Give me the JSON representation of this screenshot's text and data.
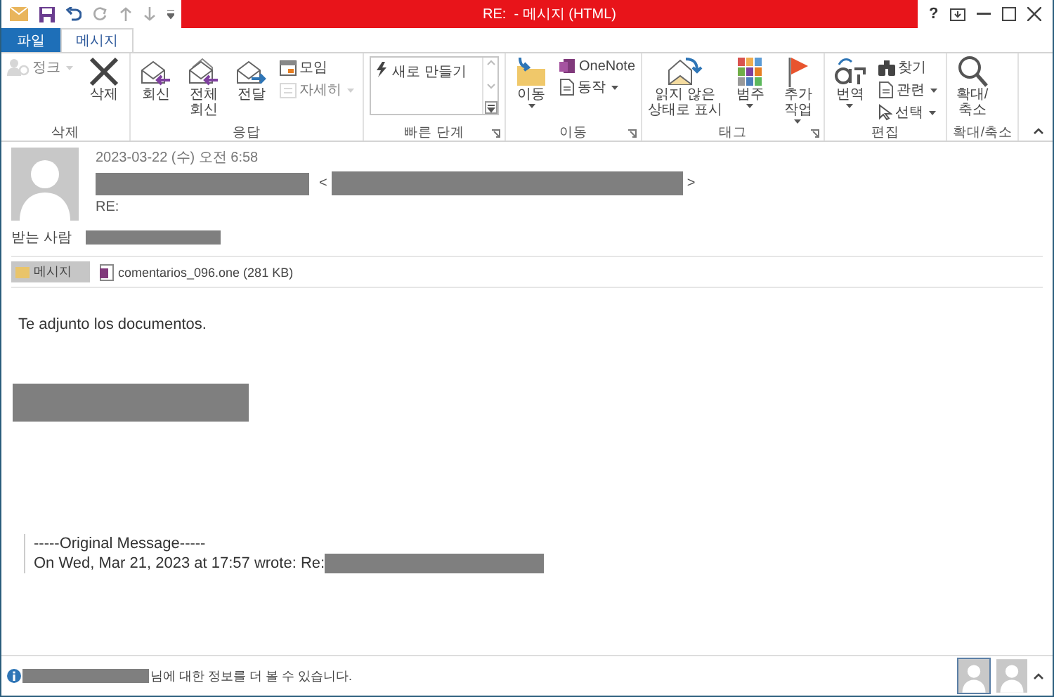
{
  "window": {
    "title": "RE:  - 메시지 (HTML)",
    "help": "?"
  },
  "tabs": [
    {
      "label": "파일",
      "kind": "file",
      "selected": false
    },
    {
      "label": "메시지",
      "kind": "tab",
      "selected": true
    }
  ],
  "ribbon": {
    "groups": [
      {
        "label": "삭제",
        "launcher": false,
        "items": [
          {
            "kind": "small",
            "label": "정크",
            "disabled": true,
            "dropdown": true
          },
          {
            "kind": "large",
            "label": "삭제",
            "disabled": false,
            "dropdown": false
          }
        ]
      },
      {
        "label": "응답",
        "launcher": false,
        "items": [
          {
            "kind": "large",
            "label": "회신",
            "disabled": false,
            "dropdown": false
          },
          {
            "kind": "large",
            "label": "전체\n회신",
            "disabled": false,
            "dropdown": false
          },
          {
            "kind": "large",
            "label": "전달",
            "disabled": false,
            "dropdown": false
          },
          {
            "kind": "small",
            "label": "모임",
            "disabled": false,
            "dropdown": false
          },
          {
            "kind": "small",
            "label": "자세히",
            "disabled": true,
            "dropdown": true
          }
        ]
      },
      {
        "label": "빠른 단계",
        "launcher": true,
        "items": [
          {
            "kind": "gallery",
            "label": "새로 만들기",
            "disabled": false,
            "dropdown": false
          }
        ]
      },
      {
        "label": "이동",
        "launcher": true,
        "items": [
          {
            "kind": "large",
            "label": "이동",
            "disabled": false,
            "dropdown": true
          },
          {
            "kind": "small",
            "label": "OneNote",
            "disabled": false,
            "dropdown": false
          },
          {
            "kind": "small",
            "label": "동작",
            "disabled": false,
            "dropdown": true
          }
        ]
      },
      {
        "label": "태그",
        "launcher": true,
        "items": [
          {
            "kind": "large",
            "label": "읽지 않은\n상태로 표시",
            "disabled": false,
            "dropdown": false
          },
          {
            "kind": "large",
            "label": "범주",
            "disabled": false,
            "dropdown": true
          },
          {
            "kind": "large",
            "label": "추가\n작업",
            "disabled": false,
            "dropdown": true
          }
        ]
      },
      {
        "label": "편집",
        "launcher": false,
        "items": [
          {
            "kind": "large",
            "label": "번역",
            "disabled": false,
            "dropdown": true
          },
          {
            "kind": "small",
            "label": "찾기",
            "disabled": false,
            "dropdown": false
          },
          {
            "kind": "small",
            "label": "관련",
            "disabled": false,
            "dropdown": true
          },
          {
            "kind": "small",
            "label": "선택",
            "disabled": false,
            "dropdown": true
          }
        ]
      },
      {
        "label": "확대/축소",
        "launcher": false,
        "items": [
          {
            "kind": "large",
            "label": "확대/\n축소",
            "disabled": false,
            "dropdown": false
          }
        ]
      }
    ]
  },
  "header": {
    "date": "2023-03-22 (수) 오전 6:58",
    "address_open": "<",
    "address_close": ">",
    "subject": "RE:",
    "to_label": "받는 사람"
  },
  "attachments": [
    {
      "kind": "message",
      "label": "메시지",
      "selected": true
    },
    {
      "kind": "file",
      "label": "comentarios_096.one (281 KB)",
      "selected": false
    }
  ],
  "body": {
    "text": "Te adjunto los documentos.",
    "quote_title": "-----Original Message-----",
    "quote_line": "On Wed, Mar 21, 2023 at 17:57 wrote: Re:"
  },
  "status_bar": {
    "text": "님에 대한 정보를 더 볼 수 있습니다.",
    "people": [
      {
        "selected": true
      },
      {
        "selected": false
      }
    ]
  }
}
